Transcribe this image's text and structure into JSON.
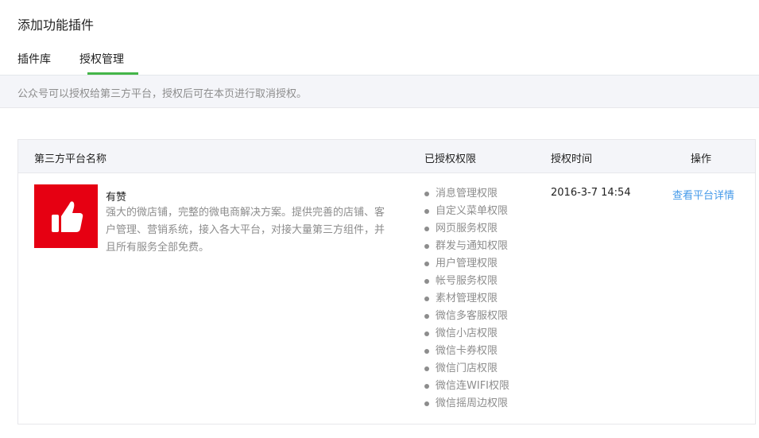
{
  "page": {
    "title": "添加功能插件"
  },
  "tabs": [
    {
      "label": "插件库",
      "active": false
    },
    {
      "label": "授权管理",
      "active": true
    }
  ],
  "accent_color": "#44b549",
  "notice": "公众号可以授权给第三方平台，授权后可在本页进行取消授权。",
  "table": {
    "headers": {
      "name": "第三方平台名称",
      "permissions": "已授权权限",
      "time": "授权时间",
      "operation": "操作"
    },
    "rows": [
      {
        "logo_icon": "thumbs-up-icon",
        "logo_color": "#e60012",
        "name": "有赞",
        "description": "强大的微店铺，完整的微电商解决方案。提供完善的店铺、客户管理、营销系统，接入各大平台，对接大量第三方组件，并且所有服务全部免费。",
        "permissions": [
          "消息管理权限",
          "自定义菜单权限",
          "网页服务权限",
          "群发与通知权限",
          "用户管理权限",
          "帐号服务权限",
          "素材管理权限",
          "微信多客服权限",
          "微信小店权限",
          "微信卡券权限",
          "微信门店权限",
          "微信连WIFI权限",
          "微信摇周边权限"
        ],
        "auth_time": "2016-3-7 14:54",
        "action_label": "查看平台详情"
      }
    ]
  }
}
